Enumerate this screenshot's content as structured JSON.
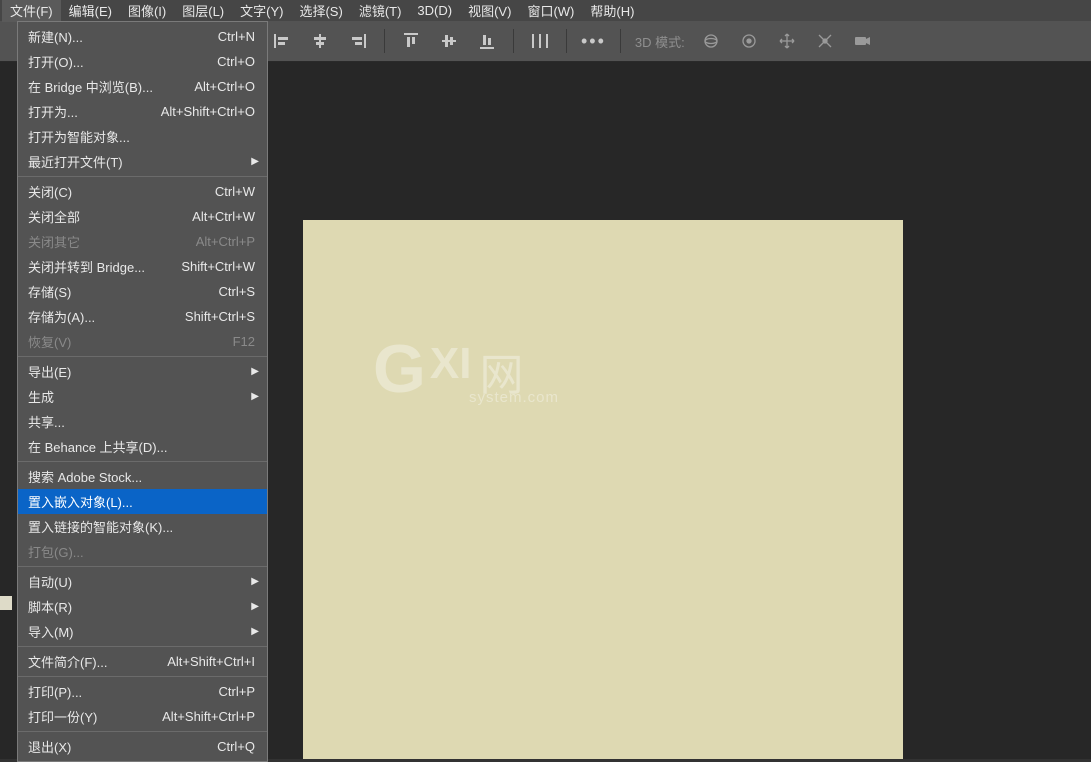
{
  "menubar": [
    {
      "label": "文件(F)"
    },
    {
      "label": "编辑(E)"
    },
    {
      "label": "图像(I)"
    },
    {
      "label": "图层(L)"
    },
    {
      "label": "文字(Y)"
    },
    {
      "label": "选择(S)"
    },
    {
      "label": "滤镜(T)"
    },
    {
      "label": "3D(D)"
    },
    {
      "label": "视图(V)"
    },
    {
      "label": "窗口(W)"
    },
    {
      "label": "帮助(H)"
    }
  ],
  "optionbar": {
    "mode_label": "3D 模式:"
  },
  "dropdown": {
    "groups": [
      [
        {
          "label": "新建(N)...",
          "shortcut": "Ctrl+N"
        },
        {
          "label": "打开(O)...",
          "shortcut": "Ctrl+O"
        },
        {
          "label": "在 Bridge 中浏览(B)...",
          "shortcut": "Alt+Ctrl+O"
        },
        {
          "label": "打开为...",
          "shortcut": "Alt+Shift+Ctrl+O"
        },
        {
          "label": "打开为智能对象..."
        },
        {
          "label": "最近打开文件(T)",
          "submenu": true
        }
      ],
      [
        {
          "label": "关闭(C)",
          "shortcut": "Ctrl+W"
        },
        {
          "label": "关闭全部",
          "shortcut": "Alt+Ctrl+W"
        },
        {
          "label": "关闭其它",
          "shortcut": "Alt+Ctrl+P",
          "disabled": true
        },
        {
          "label": "关闭并转到 Bridge...",
          "shortcut": "Shift+Ctrl+W"
        },
        {
          "label": "存储(S)",
          "shortcut": "Ctrl+S"
        },
        {
          "label": "存储为(A)...",
          "shortcut": "Shift+Ctrl+S"
        },
        {
          "label": "恢复(V)",
          "shortcut": "F12",
          "disabled": true
        }
      ],
      [
        {
          "label": "导出(E)",
          "submenu": true
        },
        {
          "label": "生成",
          "submenu": true
        },
        {
          "label": "共享..."
        },
        {
          "label": "在 Behance 上共享(D)..."
        }
      ],
      [
        {
          "label": "搜索 Adobe Stock..."
        },
        {
          "label": "置入嵌入对象(L)...",
          "highlight": true
        },
        {
          "label": "置入链接的智能对象(K)..."
        },
        {
          "label": "打包(G)...",
          "disabled": true
        }
      ],
      [
        {
          "label": "自动(U)",
          "submenu": true
        },
        {
          "label": "脚本(R)",
          "submenu": true
        },
        {
          "label": "导入(M)",
          "submenu": true
        }
      ],
      [
        {
          "label": "文件简介(F)...",
          "shortcut": "Alt+Shift+Ctrl+I"
        }
      ],
      [
        {
          "label": "打印(P)...",
          "shortcut": "Ctrl+P"
        },
        {
          "label": "打印一份(Y)",
          "shortcut": "Alt+Shift+Ctrl+P"
        }
      ],
      [
        {
          "label": "退出(X)",
          "shortcut": "Ctrl+Q"
        }
      ]
    ]
  },
  "watermark": {
    "g": "G",
    "xi": "XI",
    "net": "网",
    "sub": "system.com"
  }
}
